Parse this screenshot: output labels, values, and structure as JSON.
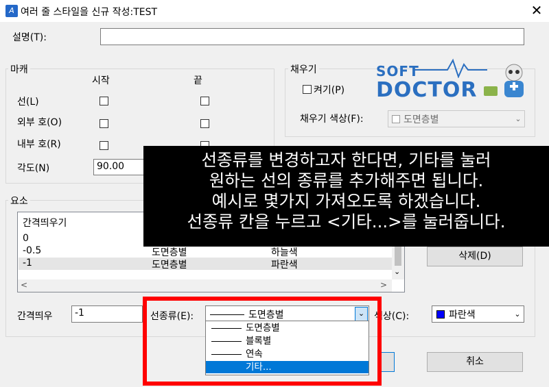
{
  "window": {
    "title": "여러 줄 스타일을 신규 작성:TEST",
    "close": "✕"
  },
  "description": {
    "label": "설명(T):",
    "value": ""
  },
  "caps": {
    "group_label": "마캐",
    "col_start": "시작",
    "col_end": "끝",
    "rows": [
      {
        "label": "선(L)",
        "start_checked": false,
        "end_checked": false
      },
      {
        "label": "외부 호(O)",
        "start_checked": false,
        "end_checked": false
      },
      {
        "label": "내부 호(R)",
        "start_checked": false,
        "end_checked": false
      }
    ],
    "angle_label": "각도(N)",
    "angle_value": "90.00"
  },
  "fill": {
    "group_label": "채우기",
    "on_label": "켜기(P)",
    "color_label": "채우기 색상(F):",
    "color_value": "도면층별"
  },
  "logo": {
    "line1": "SOFT",
    "line2": "DOCTOR"
  },
  "elements": {
    "group_label": "요소",
    "header_offset": "간격띄우기",
    "rows": [
      {
        "offset": "0",
        "color": "",
        "linetype": ""
      },
      {
        "offset": "-0.5",
        "color": "도면층별",
        "linetype": "하늘색"
      },
      {
        "offset": "-1",
        "color": "도면층별",
        "linetype": "파란색"
      }
    ],
    "delete_button": "삭제(D)",
    "offset_label": "간격띄우",
    "offset_value": "-1",
    "linetype_label": "선종류(E):",
    "linetype_value": "도면층별",
    "color_label": "색상(C):",
    "color_value": "파란색",
    "color_swatch": "#0000ff"
  },
  "dropdown_options": [
    "도면층별",
    "블록별",
    "연속",
    "기타..."
  ],
  "dropdown_selected": 3,
  "cancel_button": "취소",
  "overlay_lines": [
    "선종류를 변경하고자 한다면, 기타를 눌러",
    "원하는 선의 종류를 추가해주면 됩니다.",
    "예시로 몇가지 가져오도록 하겠습니다.",
    "선종류 칸을 누르고 <기타...>를 눌러줍니다."
  ],
  "colors": {
    "highlight": "#0078d7",
    "annotation_box": "#ff0000",
    "logo": "#2b6fc0"
  }
}
